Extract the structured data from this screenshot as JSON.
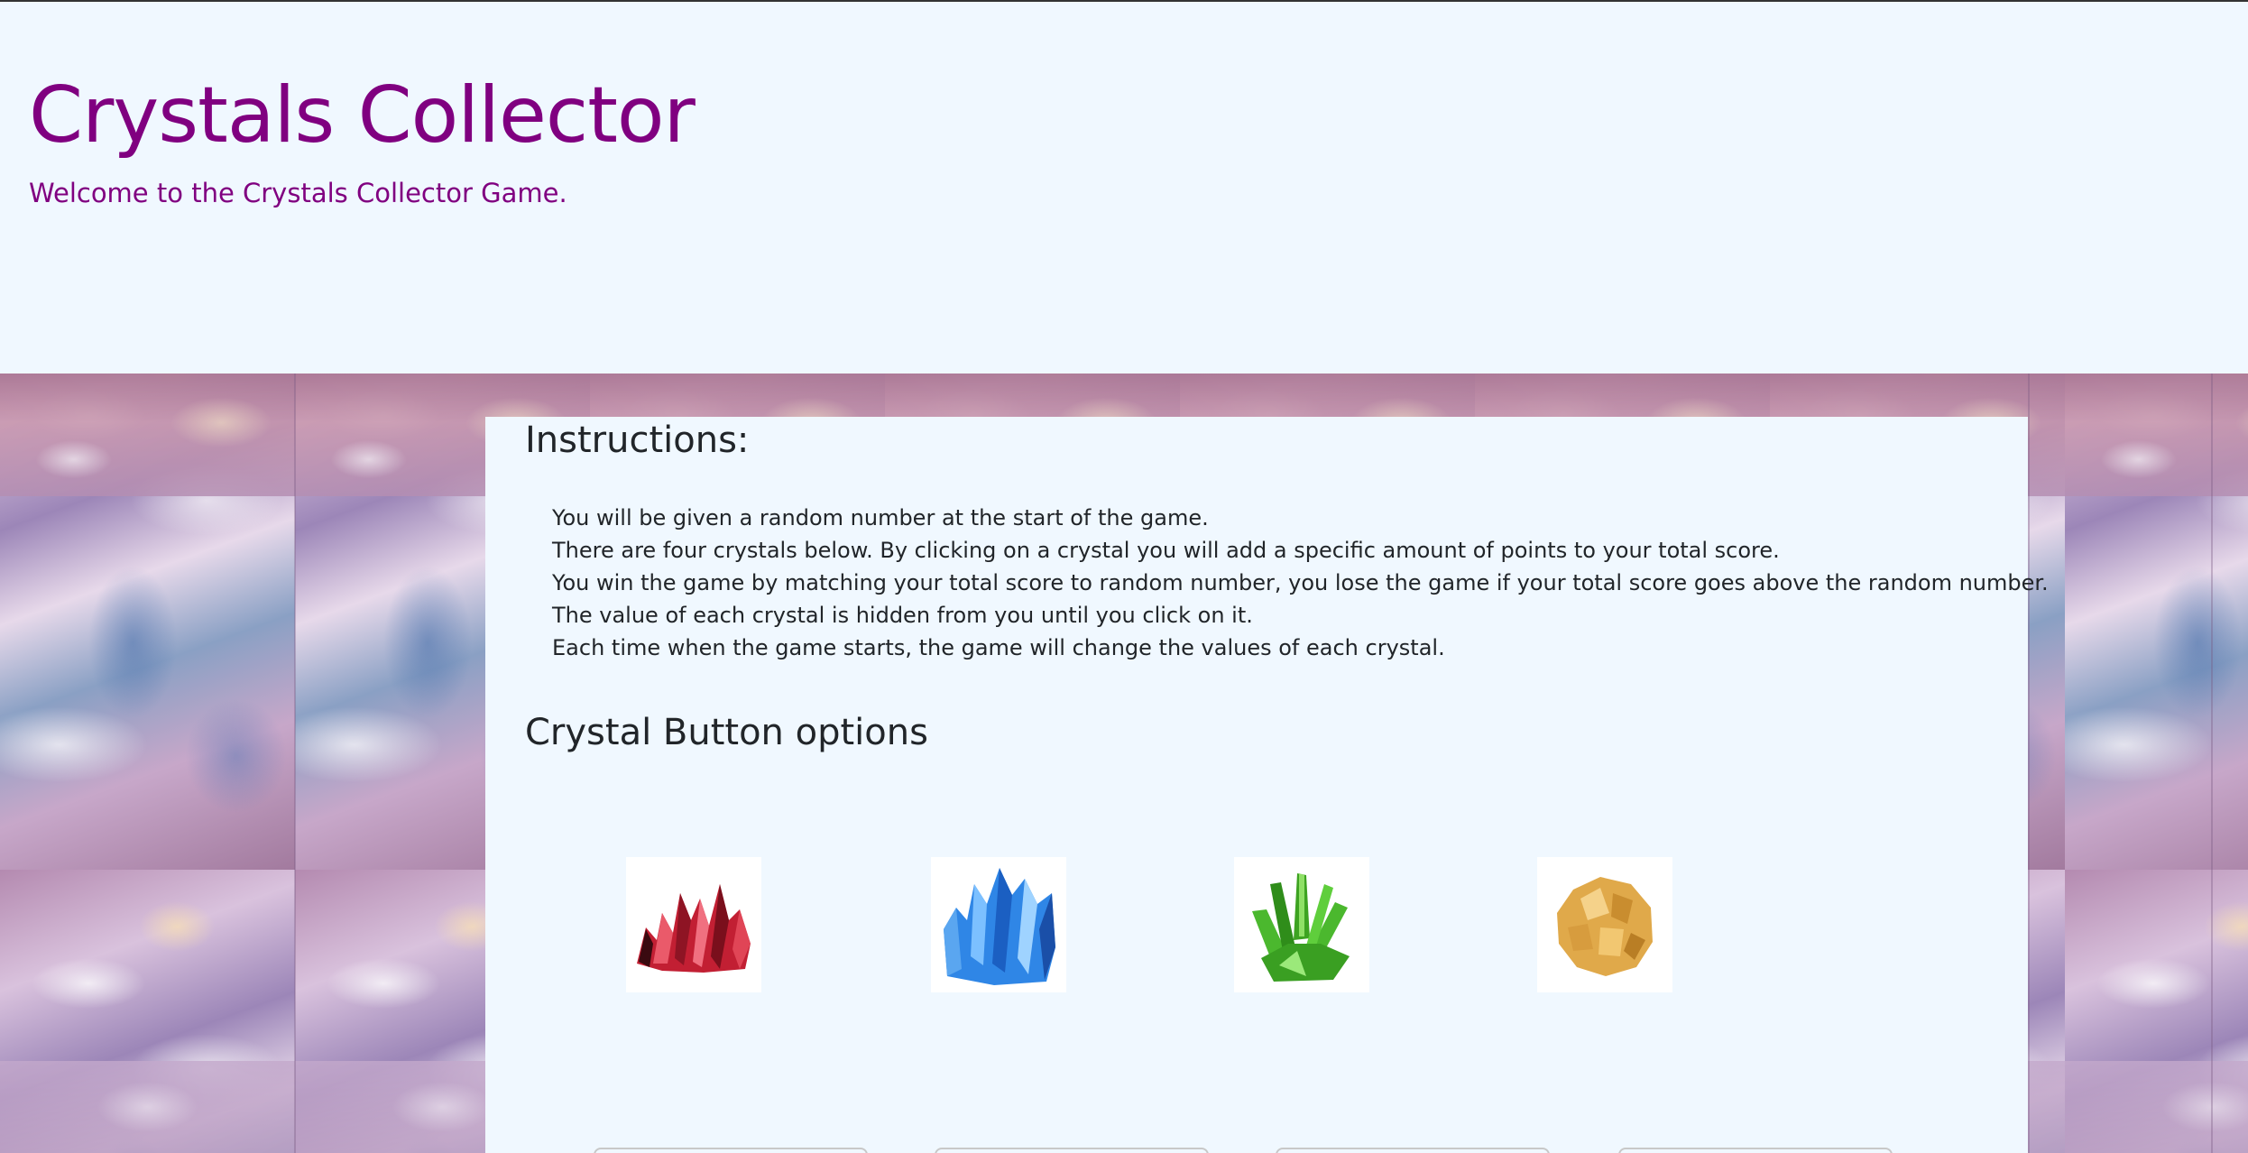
{
  "header": {
    "title": "Crystals Collector",
    "subtitle": "Welcome to the Crystals Collector Game."
  },
  "instructions": {
    "title": "Instructions:",
    "items": [
      "You will be given a random number at the start of the game.",
      "There are four crystals below. By clicking on a crystal you will add a specific amount of points to your total score.",
      "You win the game by matching your total score to random number, you lose the game if your total score goes above the random number.",
      "The value of each crystal is hidden from you until you click on it.",
      "Each time when the game starts, the game will change the values of each crystal."
    ]
  },
  "crystals": {
    "title": "Crystal Button options",
    "buttons": [
      {
        "icon": "red-crystal-icon",
        "color": "#d0283c"
      },
      {
        "icon": "blue-crystal-icon",
        "color": "#2f86e6"
      },
      {
        "icon": "green-crystal-icon",
        "color": "#49b52c"
      },
      {
        "icon": "yellow-crystal-icon",
        "color": "#e3b04e"
      }
    ]
  },
  "colors": {
    "title": "#800080",
    "background": "#f0f8ff",
    "text": "#212529"
  }
}
